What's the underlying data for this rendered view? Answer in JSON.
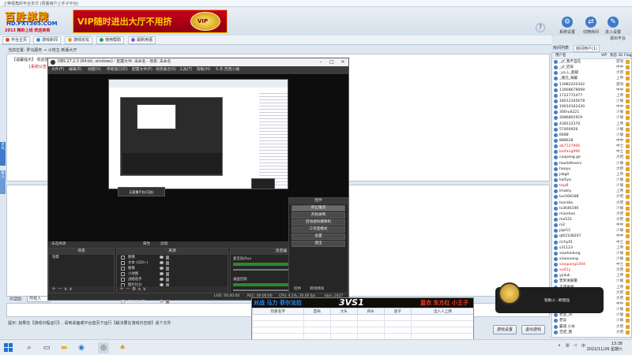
{
  "app": {
    "window_title": "上帝视角的平台支付 (原版用户上手子平台)",
    "logo": {
      "line1": "百胜棋牌",
      "line2": "HD.FXT365.COM",
      "line3": "2013 精彩上线 欢迎来到"
    },
    "vip_ad": "VIP随时进出大厅不用挤",
    "vip_emblem": "VIP",
    "toolbar": [
      {
        "label": "系统设置",
        "icon": "gear-icon"
      },
      {
        "label": "切换房间",
        "icon": "swap-icon"
      },
      {
        "label": "进入设置",
        "icon": "settings-icon"
      },
      {
        "label": "退出平台",
        "icon": "power-icon"
      }
    ]
  },
  "nav_tabs": [
    "平台主页",
    "游戏新闻",
    "游戏论坛",
    "使用帮助",
    "最新用语"
  ],
  "breadcrumb": "当前位置: 罗马服务 → 斗地主-新版大厅",
  "main_panel": {
    "tip": "【温馨提示】 欢迎您",
    "tip_red": "[系统公告]"
  },
  "left_rail": [
    "游戏",
    "聊天"
  ],
  "send_row": {
    "label": "对话给:",
    "target": "所有人"
  },
  "hint": "提示: 如果在【游戏日程运行】, 请到桌面或平台首页下运行【解决要在游戏日志结】适个文件",
  "bottom_buttons": [
    "游戏设置",
    "退出游戏"
  ],
  "right_panel": {
    "tabs": [
      "房间列表",
      "房间用户(1)"
    ],
    "headers": [
      "用户名",
      "VIP",
      "状态",
      "ID",
      "Flag"
    ],
    "users": [
      {
        "name": "_yf_我不自在",
        "status": "游戏",
        "red": false
      },
      {
        "name": "_yf_冠军",
        "status": "中中",
        "red": false
      },
      {
        "name": "_ya_L_超级",
        "status": "大吧",
        "red": false
      },
      {
        "name": "_湘沅_海螺",
        "status": "上帝",
        "red": false
      },
      {
        "name": "13982220342",
        "status": "游戏",
        "red": false
      },
      {
        "name": "13908679099",
        "status": "中中",
        "red": false
      },
      {
        "name": "1722772477",
        "status": "上帝",
        "red": false
      },
      {
        "name": "18012345678",
        "status": "少联",
        "red": false
      },
      {
        "name": "19010162430",
        "status": "中中",
        "red": false
      },
      {
        "name": "300ru6221",
        "status": "少联",
        "red": false
      },
      {
        "name": "3086802919",
        "status": "少联",
        "red": false
      },
      {
        "name": "438512370",
        "status": "上帝",
        "red": false
      },
      {
        "name": "57460926",
        "status": "少联",
        "red": false
      },
      {
        "name": "6688",
        "status": "少联",
        "red": false
      },
      {
        "name": "888628",
        "status": "中中",
        "red": false
      },
      {
        "name": "ab7127906",
        "status": "中士",
        "red": true
      },
      {
        "name": "baifang996",
        "status": "中土",
        "red": true
      },
      {
        "name": "caopeng ge",
        "status": "大吧",
        "red": false
      },
      {
        "name": "haoliztheoni",
        "status": "少联",
        "red": false
      },
      {
        "name": "haoyu",
        "status": "大吧",
        "red": false
      },
      {
        "name": "jsbgll",
        "status": "上帝",
        "red": false
      },
      {
        "name": "kalilya",
        "status": "少联",
        "red": false
      },
      {
        "name": "la@8",
        "status": "少联",
        "red": true
      },
      {
        "name": "lmokly",
        "status": "上帝",
        "red": false
      },
      {
        "name": "lue168188",
        "status": "大吧",
        "red": false
      },
      {
        "name": "luorabu",
        "status": "大吧",
        "red": false
      },
      {
        "name": "lx3646190",
        "status": "少联",
        "red": false
      },
      {
        "name": "mianhao",
        "status": "大吧",
        "red": false
      },
      {
        "name": "ma521",
        "status": "大吧",
        "red": false
      },
      {
        "name": "ni2",
        "status": "中中",
        "red": false
      },
      {
        "name": "pipl12",
        "status": "少联",
        "red": false
      },
      {
        "name": "ql62108267",
        "status": "中中",
        "red": false
      },
      {
        "name": "richy01",
        "status": "中士",
        "red": false
      },
      {
        "name": "s31123",
        "status": "上帝",
        "red": false
      },
      {
        "name": "xiaohailong",
        "status": "少联",
        "red": false
      },
      {
        "name": "xiaoxuang",
        "status": "少联",
        "red": false
      },
      {
        "name": "xiaopang1404",
        "status": "中士",
        "red": true
      },
      {
        "name": "xu01y",
        "status": "大吧",
        "red": true
      },
      {
        "name": "yjuluk",
        "status": "上帝",
        "red": false
      },
      {
        "name": "曾贺发报警",
        "status": "少联",
        "red": false
      },
      {
        "name": "王城英刚",
        "status": "上帝",
        "red": false
      },
      {
        "name": "世界冠军",
        "status": "大吧",
        "red": false
      },
      {
        "name": "王_年",
        "status": "大吧",
        "red": false
      },
      {
        "name": "霸王别姬",
        "status": "中中",
        "red": false
      },
      {
        "name": "朱建国",
        "status": "少联",
        "red": false
      },
      {
        "name": "老豆_刘",
        "status": "少联",
        "red": false
      },
      {
        "name": "老兵",
        "status": "少联",
        "red": false
      },
      {
        "name": "霸道 小米",
        "status": "大吧",
        "red": false
      },
      {
        "name": "吉诺_我",
        "status": "大吧",
        "red": false
      }
    ]
  },
  "obs": {
    "title": "OBS 27.2.3 (64-bit, windows) - 配置文件: 未命名 - 场景: 未命名",
    "window_buttons": [
      "–",
      "□",
      "×"
    ],
    "menu": [
      "文件(F)",
      "编辑(E)",
      "视图(V)",
      "停靠窗口(D)",
      "配置文件(P)",
      "场景集合(S)",
      "工具(T)",
      "帮助(H)",
      "S·杰·苏西小播"
    ],
    "preview_toast": "无直播平台(可选)",
    "docks_bar": {
      "left": "未选择源",
      "btn1": "属性",
      "btn2": "滤镜"
    },
    "scenes": {
      "title": "场景",
      "items": [
        "场景"
      ]
    },
    "sources": {
      "title": "来源",
      "items": [
        "图像",
        "文本 (GDI+)",
        "图像",
        "小地图",
        "战绩选手",
        "图片比分",
        "画面管理",
        "比分牌",
        "显示器采集"
      ]
    },
    "mixer": {
      "title": "混音器",
      "channels": [
        {
          "name": "麦克风/Aux",
          "db": "0.0 dB"
        },
        {
          "name": "桌面音频",
          "db": "0.0 dB"
        }
      ]
    },
    "controls": {
      "title": "控件",
      "buttons": [
        "停止推流",
        "开始录制",
        "启动虚拟摄像机",
        "工作室模式",
        "设置",
        "退出"
      ],
      "tabs": [
        "控件",
        "转场特效"
      ]
    },
    "status": {
      "live": "LIVE: 00:00:00",
      "rec": "REC: 00:00:00",
      "cpu": "CPU: 4.1%, 30.00 fps",
      "kbps": "kb/s: 2427"
    }
  },
  "game_popup": {
    "left_team": "对战 马力 菲尔法拉",
    "right_team": "蓝衣 东方红 小王子",
    "vs": "3VS1",
    "headers": [
      "玩家名字",
      "首局",
      "大头",
      "四头",
      "连子",
      "出人人上牌"
    ]
  },
  "notification": {
    "text": "帮助人: 郑建强"
  },
  "taskbar": {
    "time": "13:38",
    "date": "2022/11/26 星期六",
    "lang": "中"
  }
}
